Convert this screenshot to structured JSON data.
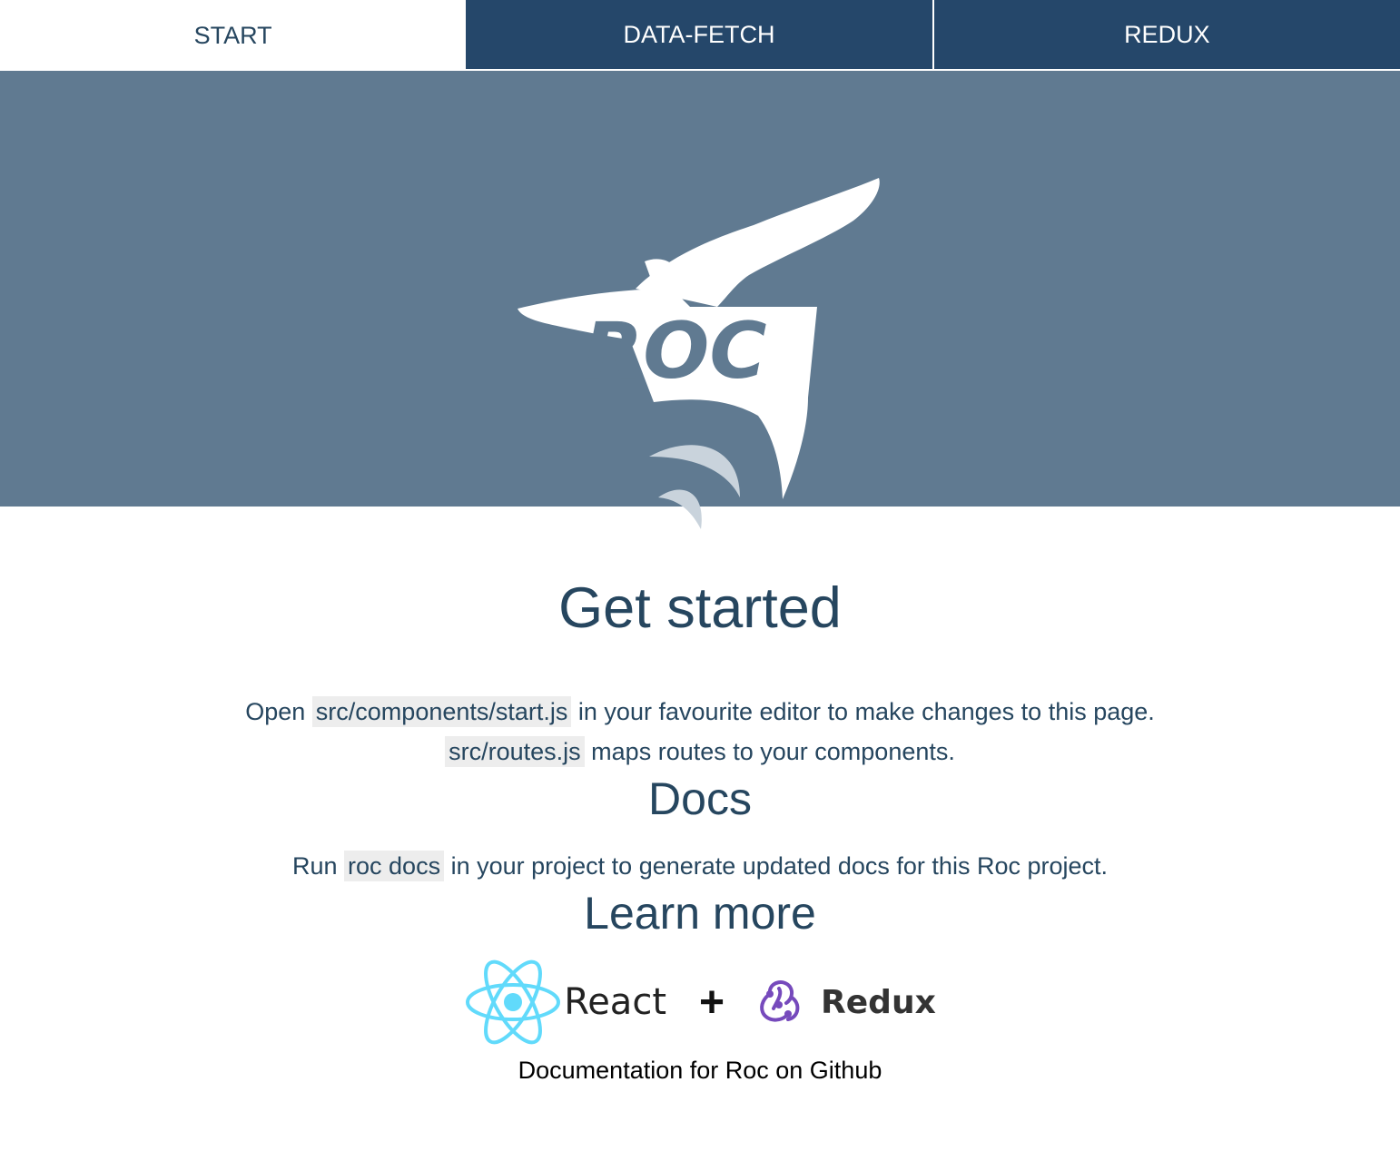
{
  "tabs": [
    {
      "label": "START"
    },
    {
      "label": "DATA-FETCH"
    },
    {
      "label": "REDUX"
    }
  ],
  "hero": {
    "logo_text": "ROC"
  },
  "main": {
    "title": "Get started",
    "intro": {
      "line1_prefix": "Open",
      "line1_code": "src/components/start.js",
      "line1_suffix": "in your favourite editor to make changes to this page.",
      "line2_code": "src/routes.js",
      "line2_suffix": "maps routes to your components."
    },
    "docs": {
      "title": "Docs",
      "prefix": "Run",
      "code": "roc docs",
      "suffix": "in your project to generate updated docs for this Roc project."
    },
    "learn": {
      "title": "Learn more",
      "react_label": "React",
      "plus": "+",
      "redux_label": "Redux",
      "link_text": "Documentation for Roc on Github"
    }
  },
  "colors": {
    "nav_bg": "#25476a",
    "hero_bg": "#607a91",
    "text": "#26465f",
    "code_bg": "#ededed",
    "react": "#61dafb",
    "redux": "#764abc"
  }
}
